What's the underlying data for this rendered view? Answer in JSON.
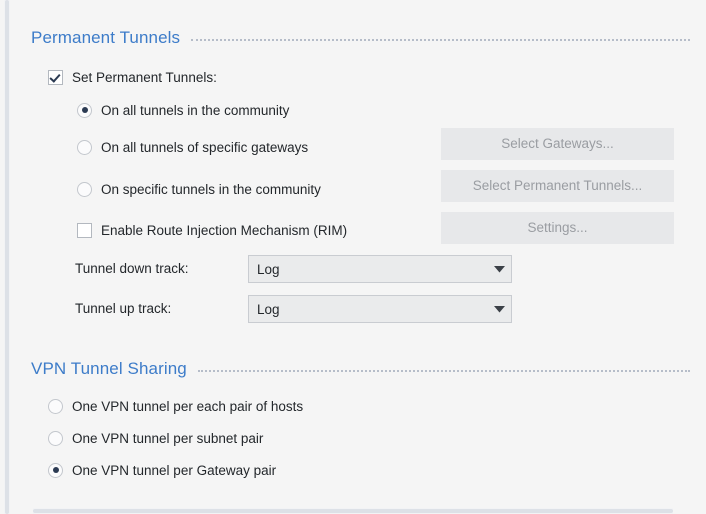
{
  "sections": [
    {
      "id": "permanent_tunnels",
      "title": "Permanent Tunnels"
    },
    {
      "id": "vpn_tunnel_sharing",
      "title": "VPN Tunnel Sharing"
    }
  ],
  "permanent_tunnels": {
    "title": "Permanent Tunnels",
    "set_permanent_tunnels": {
      "label": "Set Permanent Tunnels:",
      "checked": true
    },
    "scope_options": [
      {
        "label": "On all tunnels in the community",
        "selected": true
      },
      {
        "label": "On all tunnels of specific gateways",
        "selected": false
      },
      {
        "label": "On specific tunnels in the community",
        "selected": false
      }
    ],
    "rim": {
      "label": "Enable Route Injection Mechanism (RIM)",
      "checked": false
    },
    "buttons": [
      {
        "label": "Select Gateways...",
        "enabled": false
      },
      {
        "label": "Select Permanent Tunnels...",
        "enabled": false
      },
      {
        "label": "Settings...",
        "enabled": false
      }
    ],
    "tunnel_down_track": {
      "label": "Tunnel down track:",
      "value": "Log"
    },
    "tunnel_up_track": {
      "label": "Tunnel up track:",
      "value": "Log"
    }
  },
  "vpn_tunnel_sharing": {
    "title": "VPN Tunnel Sharing",
    "options": [
      {
        "label": "One VPN tunnel per each pair of hosts",
        "selected": false
      },
      {
        "label": "One VPN tunnel per subnet pair",
        "selected": false
      },
      {
        "label": "One VPN tunnel per Gateway pair",
        "selected": true
      }
    ]
  },
  "colors": {
    "background": "#f5f5f5",
    "section_header": "#3d7cc9",
    "text": "#23272b",
    "disabled_text": "#9a9da2",
    "button_face": "#e7e8ea",
    "combo_face": "#eaebec",
    "combo_border": "#c9ccd1",
    "rule_dots": "#b6bdc9",
    "scrollbar_thumb": "#dde1e7"
  }
}
